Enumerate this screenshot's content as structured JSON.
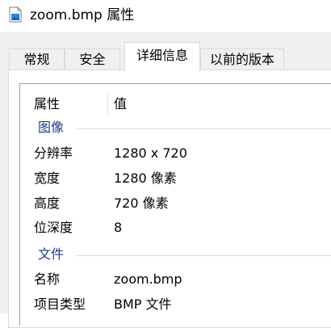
{
  "window": {
    "title": "zoom.bmp 属性"
  },
  "tabs": [
    {
      "label": "常规",
      "active": false
    },
    {
      "label": "安全",
      "active": false
    },
    {
      "label": "详细信息",
      "active": true
    },
    {
      "label": "以前的版本",
      "active": false
    }
  ],
  "list": {
    "headers": {
      "property": "属性",
      "value": "值"
    },
    "groups": [
      {
        "title": "图像",
        "rows": [
          {
            "property": "分辨率",
            "value": "1280 x 720"
          },
          {
            "property": "宽度",
            "value": "1280 像素"
          },
          {
            "property": "高度",
            "value": "720 像素"
          },
          {
            "property": "位深度",
            "value": "8"
          }
        ]
      },
      {
        "title": "文件",
        "rows": [
          {
            "property": "名称",
            "value": "zoom.bmp"
          },
          {
            "property": "项目类型",
            "value": "BMP 文件"
          }
        ]
      }
    ]
  },
  "colors": {
    "group_title": "#1e3a8a",
    "tab_border": "#d9d9d9",
    "dialog_bg": "#f0f0f0"
  }
}
